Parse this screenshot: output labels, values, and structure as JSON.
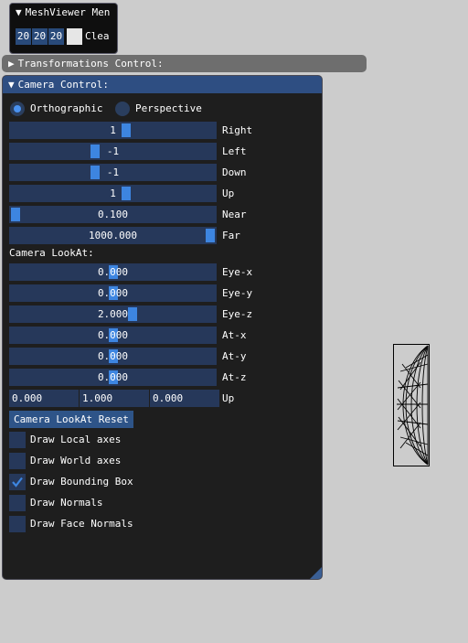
{
  "mesh_viewer": {
    "title": "MeshViewer Men",
    "values": [
      "20",
      "20",
      "20"
    ],
    "clear_label": "Clea"
  },
  "transformations": {
    "title": "Transformations Control:"
  },
  "camera": {
    "title": "Camera Control:",
    "projection": {
      "options": [
        "Orthographic",
        "Perspective"
      ],
      "selected": "Orthographic"
    },
    "projection_sliders": [
      {
        "label": "Right",
        "value": "1",
        "level": 0.57
      },
      {
        "label": "Left",
        "value": "-1",
        "level": 0.41
      },
      {
        "label": "Down",
        "value": "-1",
        "level": 0.41
      },
      {
        "label": "Up",
        "value": "1",
        "level": 0.57
      },
      {
        "label": "Near",
        "value": "0.100",
        "level": 0.0
      },
      {
        "label": "Far",
        "value": "1000.000",
        "level": 1.0
      }
    ],
    "lookat_heading": "Camera LookAt:",
    "lookat_sliders": [
      {
        "label": "Eye-x",
        "value": "0.000",
        "level": 0.5
      },
      {
        "label": "Eye-y",
        "value": "0.000",
        "level": 0.5
      },
      {
        "label": "Eye-z",
        "value": "2.000",
        "level": 0.6
      },
      {
        "label": "At-x",
        "value": "0.000",
        "level": 0.5
      },
      {
        "label": "At-y",
        "value": "0.000",
        "level": 0.5
      },
      {
        "label": "At-z",
        "value": "0.000",
        "level": 0.5
      }
    ],
    "up": {
      "label": "Up",
      "values": [
        "0.000",
        "1.000",
        "0.000"
      ]
    },
    "reset_label": "Camera LookAt Reset",
    "checkboxes": [
      {
        "label": "Draw Local axes",
        "checked": false
      },
      {
        "label": "Draw World axes",
        "checked": false
      },
      {
        "label": "Draw Bounding Box",
        "checked": true
      },
      {
        "label": "Draw Normals",
        "checked": false
      },
      {
        "label": "Draw Face Normals",
        "checked": false
      }
    ]
  },
  "colors": {
    "background": "#cccccc",
    "panel": "#1e1e1e",
    "accent": "#3d85e0",
    "frame": "#26385a",
    "title_active": "#2e4e82"
  }
}
